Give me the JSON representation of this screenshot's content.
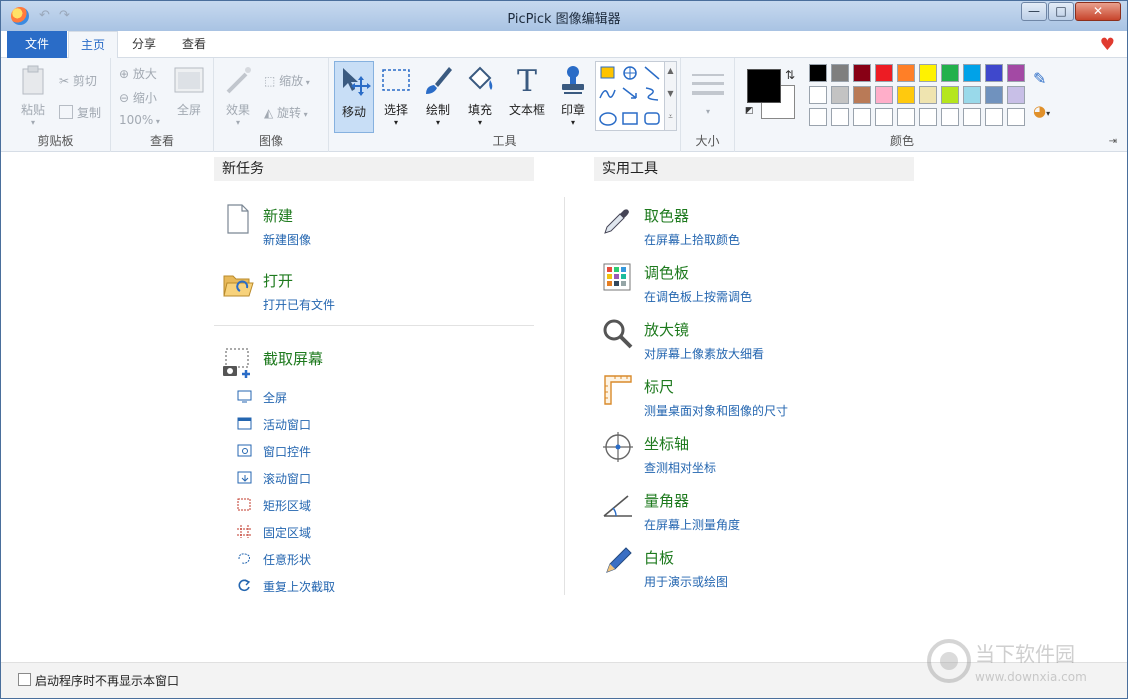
{
  "window": {
    "title": "PicPick 图像编辑器",
    "minimize": "—",
    "maximize": "□",
    "close": "✕"
  },
  "tabs": [
    {
      "label": "文件"
    },
    {
      "label": "主页"
    },
    {
      "label": "分享"
    },
    {
      "label": "查看"
    }
  ],
  "ribbon": {
    "clipboard": {
      "label": "剪贴板",
      "paste": "粘贴",
      "cut": "剪切",
      "copy": "复制"
    },
    "view": {
      "label": "查看",
      "zoom_in": "放大",
      "zoom_out": "缩小",
      "zoom_level": "100%",
      "fullscreen": "全屏"
    },
    "image": {
      "label": "图像",
      "effects": "效果",
      "resize": "缩放",
      "rotate": "旋转"
    },
    "tools": {
      "label": "工具",
      "move": "移动",
      "select": "选择",
      "draw": "绘制",
      "fill": "填充",
      "textbox": "文本框",
      "stamp": "印章"
    },
    "size": {
      "label": "大小"
    },
    "colors": {
      "label": "颜色",
      "primary": "#000000",
      "secondary": "#ffffff",
      "palette_row1": [
        "#000000",
        "#7f7f7f",
        "#880015",
        "#ed1c24",
        "#ff7f27",
        "#fff200",
        "#22b14c",
        "#00a2e8",
        "#3f48cc",
        "#a349a4"
      ],
      "palette_row2": [
        "#ffffff",
        "#c3c3c3",
        "#b97a57",
        "#ffaec9",
        "#ffc90e",
        "#efe4b0",
        "#b5e61d",
        "#99d9ea",
        "#7092be",
        "#c8bfe7"
      ],
      "palette_row3": [
        "#ffffff",
        "#ffffff",
        "#ffffff",
        "#ffffff",
        "#ffffff",
        "#ffffff",
        "#ffffff",
        "#ffffff",
        "#ffffff",
        "#ffffff"
      ]
    }
  },
  "new_task": {
    "title": "新任务",
    "new": {
      "title": "新建",
      "sub": "新建图像"
    },
    "open": {
      "title": "打开",
      "sub": "打开已有文件"
    },
    "capture": {
      "title": "截取屏幕",
      "items": [
        "全屏",
        "活动窗口",
        "窗口控件",
        "滚动窗口",
        "矩形区域",
        "固定区域",
        "任意形状",
        "重复上次截取"
      ]
    }
  },
  "utilities": {
    "title": "实用工具",
    "items": [
      {
        "title": "取色器",
        "sub": "在屏幕上拾取颜色"
      },
      {
        "title": "调色板",
        "sub": "在调色板上按需调色"
      },
      {
        "title": "放大镜",
        "sub": "对屏幕上像素放大细看"
      },
      {
        "title": "标尺",
        "sub": "测量桌面对象和图像的尺寸"
      },
      {
        "title": "坐标轴",
        "sub": "查测相对坐标"
      },
      {
        "title": "量角器",
        "sub": "在屏幕上测量角度"
      },
      {
        "title": "白板",
        "sub": "用于演示或绘图"
      }
    ]
  },
  "footer": {
    "checkbox_label": "启动程序时不再显示本窗口"
  },
  "watermark": {
    "cn": "当下软件园",
    "url": "www.downxia.com"
  }
}
